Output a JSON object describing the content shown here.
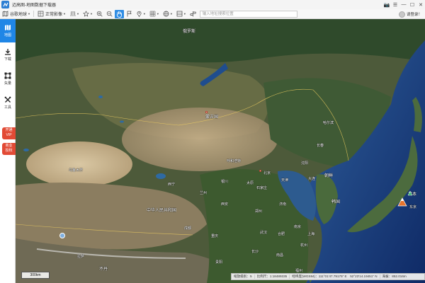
{
  "app": {
    "title": "迈高图-地图数据下载器"
  },
  "window_controls": [
    "📷",
    "☰",
    "—",
    "☐",
    "✕"
  ],
  "toolbar": {
    "basemap_label": "谷歌地球",
    "imagery_label": "正常影像",
    "search": {
      "value": "",
      "placeholder": "输入地址搜索位置"
    }
  },
  "user": {
    "label": "请登录！"
  },
  "sidebar": {
    "items": [
      {
        "label": "地图",
        "icon": "map-icon",
        "active": true
      },
      {
        "label": "下载",
        "icon": "download-icon"
      },
      {
        "label": "矢量",
        "icon": "vector-icon"
      },
      {
        "label": "工具",
        "icon": "tools-icon"
      }
    ],
    "promo_vip": "开通\nVIP",
    "promo_auth": "商业\n授权"
  },
  "map": {
    "countries": [
      {
        "name": "蒙古国"
      },
      {
        "name": "中华人民共和国"
      },
      {
        "name": "日本"
      },
      {
        "name": "韩国"
      },
      {
        "name": "朝鲜"
      },
      {
        "name": "俄罗斯"
      },
      {
        "name": "不丹"
      }
    ],
    "cities": [
      "北京",
      "乌鲁木齐",
      "兰州",
      "呼和浩特",
      "哈尔滨",
      "长春",
      "沈阳",
      "天津",
      "大连",
      "石家庄",
      "太原",
      "银川",
      "西宁",
      "西安",
      "郑州",
      "济南",
      "南京",
      "上海",
      "杭州",
      "武汉",
      "长沙",
      "成都",
      "重庆",
      "拉萨",
      "贵阳",
      "南昌",
      "福州",
      "合肥",
      "东京"
    ]
  },
  "scale": {
    "label": "300km"
  },
  "status": {
    "zoom": "缩放级别：5",
    "ratio": "比例尺：1:18489335",
    "coord": "经纬度(WGS84)：111°01′47.79175″ E　52°23′14.19451″ N",
    "elevation": "海拔：852.016m"
  }
}
